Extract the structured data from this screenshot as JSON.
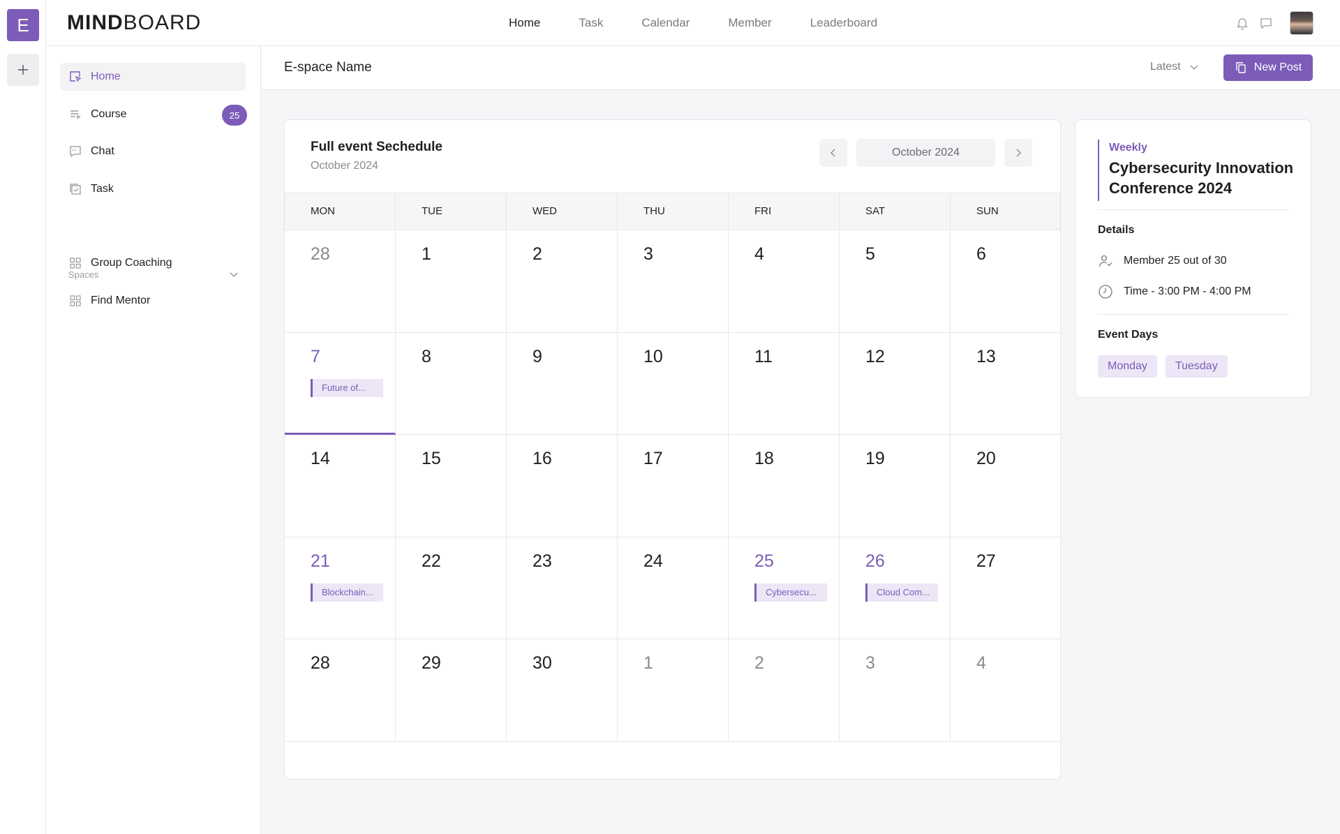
{
  "rail": {
    "workspace_initial": "E"
  },
  "brand": {
    "bold": "MIND",
    "light": "BOARD"
  },
  "topnav": [
    "Home",
    "Task",
    "Calendar",
    "Member",
    "Leaderboard"
  ],
  "sidebar": {
    "items": [
      {
        "label": "Home",
        "icon": "cursor-box-icon"
      },
      {
        "label": "Course",
        "icon": "playlist-icon",
        "badge": "25"
      },
      {
        "label": "Chat",
        "icon": "chat-icon"
      },
      {
        "label": "Task",
        "icon": "task-icon"
      }
    ],
    "spaces_label": "Spaces",
    "spaces": [
      {
        "label": "Group Coaching",
        "icon": "grid-icon"
      },
      {
        "label": "Find Mentor",
        "icon": "grid-icon"
      }
    ]
  },
  "content_header": {
    "title": "E-space Name",
    "sort": "Latest",
    "new_post": "New Post"
  },
  "calendar": {
    "title": "Full event Sechedule",
    "subtitle": "October 2024",
    "month_label": "October 2024",
    "weekdays": [
      "MON",
      "TUE",
      "WED",
      "THU",
      "FRI",
      "SAT",
      "SUN"
    ],
    "days": [
      {
        "n": "28",
        "muted": true
      },
      {
        "n": "1"
      },
      {
        "n": "2"
      },
      {
        "n": "3"
      },
      {
        "n": "4"
      },
      {
        "n": "5"
      },
      {
        "n": "6"
      },
      {
        "n": "7",
        "hl": true,
        "today": true,
        "event": "Future of..."
      },
      {
        "n": "8"
      },
      {
        "n": "9"
      },
      {
        "n": "10"
      },
      {
        "n": "11"
      },
      {
        "n": "12"
      },
      {
        "n": "13"
      },
      {
        "n": "14"
      },
      {
        "n": "15"
      },
      {
        "n": "16"
      },
      {
        "n": "17"
      },
      {
        "n": "18"
      },
      {
        "n": "19"
      },
      {
        "n": "20"
      },
      {
        "n": "21",
        "hl": true,
        "event": "Blockchain..."
      },
      {
        "n": "22"
      },
      {
        "n": "23"
      },
      {
        "n": "24"
      },
      {
        "n": "25",
        "hl": true,
        "event": "Cybersecu..."
      },
      {
        "n": "26",
        "hl": true,
        "event": "Cloud Com..."
      },
      {
        "n": "27"
      },
      {
        "n": "28"
      },
      {
        "n": "29"
      },
      {
        "n": "30"
      },
      {
        "n": "1",
        "muted": true
      },
      {
        "n": "2",
        "muted": true
      },
      {
        "n": "3",
        "muted": true
      },
      {
        "n": "4",
        "muted": true
      }
    ]
  },
  "detail": {
    "frequency": "Weekly",
    "title": "Cybersecurity Innovation Conference 2024",
    "details_label": "Details",
    "members": "Member 25 out of 30",
    "time": "Time - 3:00 PM - 4:00 PM",
    "event_days_label": "Event Days",
    "event_days": [
      "Monday",
      "Tuesday"
    ]
  },
  "colors": {
    "accent": "#7c5cb8",
    "accent_light": "#ece6f6"
  }
}
